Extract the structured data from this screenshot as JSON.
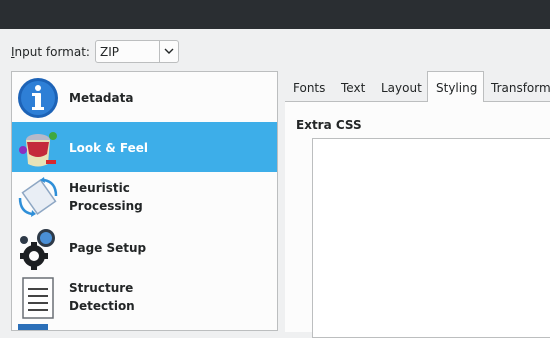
{
  "input_format": {
    "label_underlined": "I",
    "label_rest": "nput format:",
    "value": "ZIP"
  },
  "sidebar": {
    "items": [
      {
        "label": "Metadata",
        "icon": "info-icon",
        "selected": false
      },
      {
        "label": "Look & Feel",
        "icon": "paint-bucket-icon",
        "selected": true
      },
      {
        "label": "Heuristic\nProcessing",
        "icon": "heuristic-icon",
        "selected": false
      },
      {
        "label": "Page Setup",
        "icon": "gears-icon",
        "selected": false
      },
      {
        "label": "Structure\nDetection",
        "icon": "document-icon",
        "selected": false
      }
    ]
  },
  "tabs": [
    {
      "label": "Fonts"
    },
    {
      "label": "Text"
    },
    {
      "label": "Layout"
    },
    {
      "label": "Styling"
    },
    {
      "label": "Transform"
    }
  ],
  "styling": {
    "extra_css_label": "Extra CSS",
    "extra_css_value": ""
  },
  "colors": {
    "titlebar": "#2a2e32",
    "selection": "#3daee9",
    "window": "#eff0f1"
  }
}
